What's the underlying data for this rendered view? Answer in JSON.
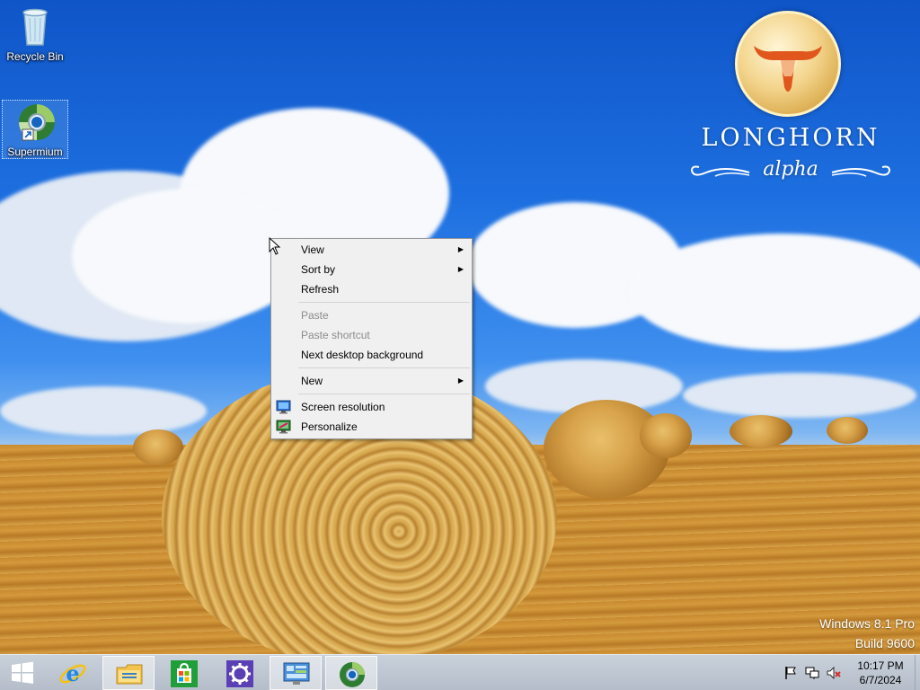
{
  "desktop": {
    "icons": [
      {
        "label": "Recycle Bin",
        "icon": "recycle-bin-icon"
      },
      {
        "label": "Supermium",
        "icon": "supermium-browser-icon"
      }
    ],
    "logo": {
      "title": "LONGHORN",
      "subtitle": "alpha"
    },
    "watermark": {
      "edition": "Windows 8.1 Pro",
      "build": "Build 9600"
    }
  },
  "context_menu": {
    "items": [
      {
        "label": "View",
        "submenu": true,
        "enabled": true
      },
      {
        "label": "Sort by",
        "submenu": true,
        "enabled": true
      },
      {
        "label": "Refresh",
        "submenu": false,
        "enabled": true
      },
      {
        "label": "Paste",
        "submenu": false,
        "enabled": false
      },
      {
        "label": "Paste shortcut",
        "submenu": false,
        "enabled": false
      },
      {
        "label": "Next desktop background",
        "submenu": false,
        "enabled": true
      },
      {
        "label": "New",
        "submenu": true,
        "enabled": true
      },
      {
        "label": "Screen resolution",
        "submenu": false,
        "enabled": true,
        "icon": "screen-resolution-icon"
      },
      {
        "label": "Personalize",
        "submenu": false,
        "enabled": true,
        "icon": "personalize-icon"
      }
    ]
  },
  "taskbar": {
    "buttons": [
      {
        "icon": "windows-start-icon"
      },
      {
        "icon": "internet-explorer-icon"
      },
      {
        "icon": "file-explorer-icon"
      },
      {
        "icon": "store-icon"
      },
      {
        "icon": "settings-gear-icon"
      },
      {
        "icon": "control-panel-icon"
      },
      {
        "icon": "supermium-browser-icon"
      }
    ],
    "tray": {
      "icons": [
        "action-center-flag-icon",
        "network-icon",
        "volume-muted-icon"
      ],
      "time": "10:17 PM",
      "date": "6/7/2024"
    }
  },
  "colors": {
    "sky": "#1d6fe0",
    "field": "#c98a2e",
    "menu_bg": "#f0f0f0",
    "taskbar": "#bfc7d2"
  }
}
